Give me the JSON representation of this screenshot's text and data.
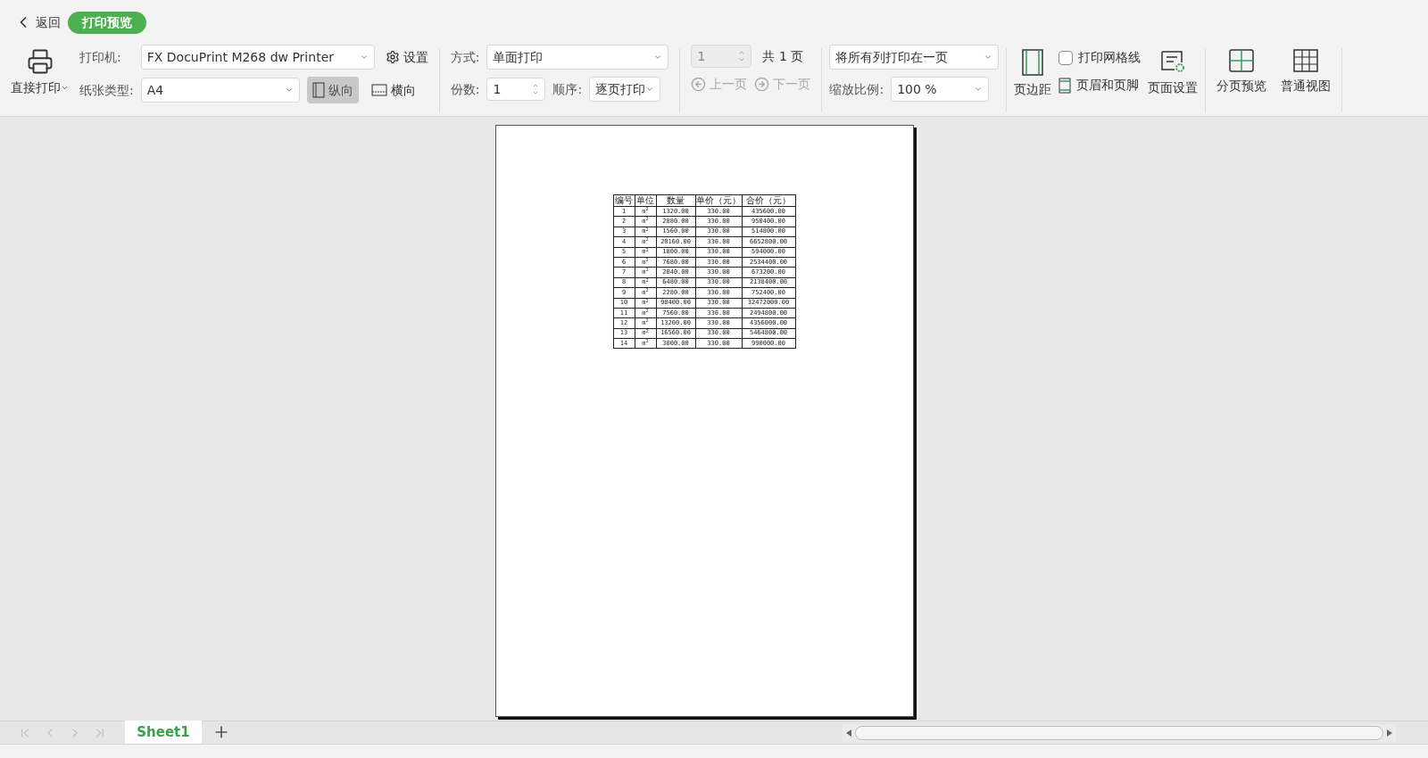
{
  "header": {
    "back": "返回",
    "mode": "打印预览"
  },
  "ribbon": {
    "direct_print": "直接打印",
    "printer_label": "打印机:",
    "printer": "FX DocuPrint M268 dw Printer",
    "settings": "设置",
    "paper_label": "纸张类型:",
    "paper": "A4",
    "orientations": [
      {
        "label": "纵向",
        "selected": true
      },
      {
        "label": "横向",
        "selected": false
      }
    ],
    "method_label": "方式:",
    "method": "单面打印",
    "copies_label": "份数:",
    "copies": "1",
    "order_label": "顺序:",
    "order": "逐页打印",
    "page_input": "1",
    "total": "共 1 页",
    "prev": "上一页",
    "next": "下一页",
    "fit": "将所有列打印在一页",
    "zoom_label": "缩放比例:",
    "zoom": "100 %",
    "margins": "页边距",
    "gridlines": {
      "label": "打印网格线",
      "checked": false
    },
    "header_footer": "页眉和页脚",
    "page_setup": "页面设置",
    "page_break": "分页预览",
    "normal_view": "普通视图"
  },
  "table": {
    "columns": [
      "编号",
      "单位",
      "数量",
      "单价（元）",
      "合价（元）"
    ],
    "rows": [
      [
        "1",
        "m$^{2}$",
        "1320.00",
        "330.00",
        "435600.00"
      ],
      [
        "2",
        "m$^{2}$",
        "2880.00",
        "330.00",
        "950400.00"
      ],
      [
        "3",
        "m$^{2}$",
        "1560.00",
        "330.00",
        "514800.00"
      ],
      [
        "4",
        "m$^{2}$",
        "20160.00",
        "330.00",
        "6652800.00"
      ],
      [
        "5",
        "m$^{2}$",
        "1800.00",
        "330.00",
        "594000.00"
      ],
      [
        "6",
        "m$^{2}$",
        "7680.00",
        "330.00",
        "2534400.00"
      ],
      [
        "7",
        "m$^{2}$",
        "2040.00",
        "330.00",
        "673200.00"
      ],
      [
        "8",
        "m$^{2}$",
        "6480.00",
        "330.00",
        "2138400.00"
      ],
      [
        "9",
        "m$^{2}$",
        "2280.00",
        "330.00",
        "752400.00"
      ],
      [
        "10",
        "m$^{2}$",
        "98400.00",
        "330.00",
        "32472000.00"
      ],
      [
        "11",
        "m$^{2}$",
        "7560.00",
        "330.00",
        "2494800.00"
      ],
      [
        "12",
        "m$^{2}$",
        "13200.00",
        "330.00",
        "4356000.00"
      ],
      [
        "13",
        "m$^{2}$",
        "16560.00",
        "330.00",
        "5464800.00"
      ],
      [
        "14",
        "m$^{2}$",
        "3000.00",
        "330.00",
        "990000.00"
      ]
    ]
  },
  "sheet_tabs": [
    {
      "label": "Sheet1",
      "selected": true
    }
  ]
}
